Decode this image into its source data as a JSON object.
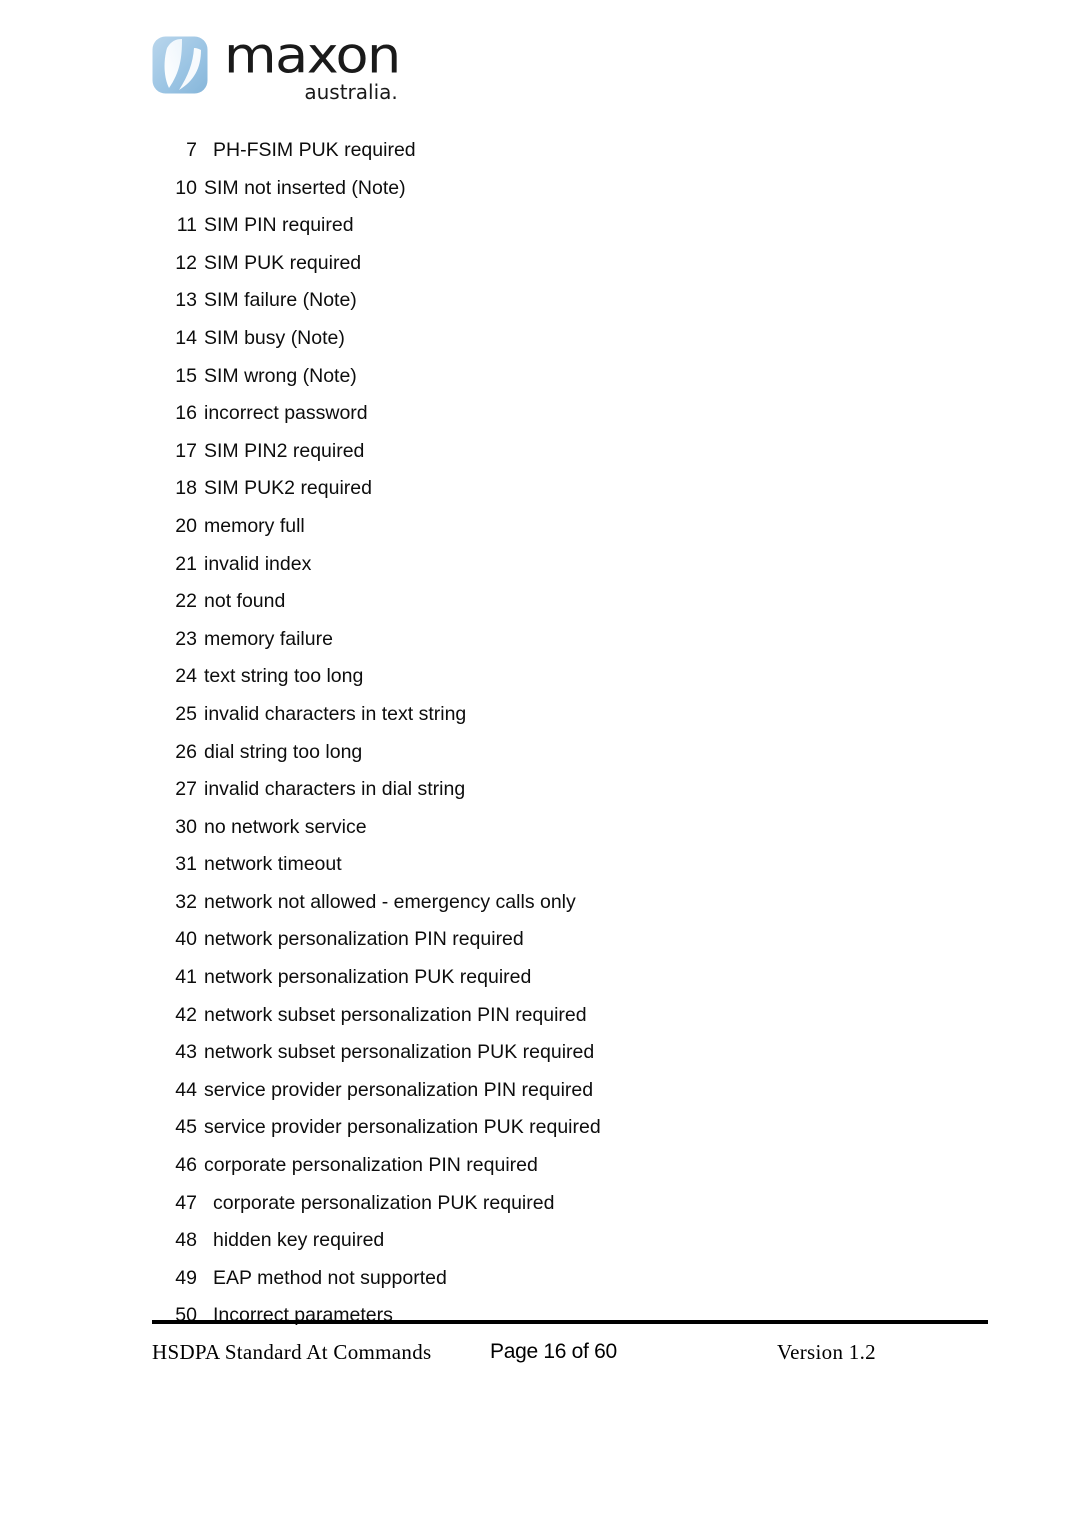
{
  "header": {
    "logo": {
      "mark_icon": "maxon-leaf-mark-icon",
      "mark_color": "#a9cbe6",
      "mark_color_dark": "#8cb9dd",
      "mark_highlight": "#ffffff",
      "wordmark": "maxon",
      "tagline": "australia.",
      "text_color": "#1a1a1a"
    }
  },
  "main": {
    "error_codes": [
      {
        "code": "7",
        "desc": "PH-FSIM PUK required",
        "wide": true
      },
      {
        "code": "10",
        "desc": "SIM not inserted (Note)",
        "wide": false
      },
      {
        "code": "11",
        "desc": "SIM PIN required",
        "wide": false
      },
      {
        "code": "12",
        "desc": "SIM PUK required",
        "wide": false
      },
      {
        "code": "13",
        "desc": "SIM failure (Note)",
        "wide": false
      },
      {
        "code": "14",
        "desc": "SIM busy (Note)",
        "wide": false
      },
      {
        "code": "15",
        "desc": "SIM wrong (Note)",
        "wide": false
      },
      {
        "code": "16",
        "desc": "incorrect password",
        "wide": false
      },
      {
        "code": "17",
        "desc": "SIM PIN2 required",
        "wide": false
      },
      {
        "code": "18",
        "desc": "SIM PUK2 required",
        "wide": false
      },
      {
        "code": "20",
        "desc": "memory full",
        "wide": false
      },
      {
        "code": "21",
        "desc": "invalid index",
        "wide": false
      },
      {
        "code": "22",
        "desc": "not found",
        "wide": false
      },
      {
        "code": "23",
        "desc": "memory failure",
        "wide": false
      },
      {
        "code": "24",
        "desc": "text string too long",
        "wide": false
      },
      {
        "code": "25",
        "desc": "invalid characters in text string",
        "wide": false
      },
      {
        "code": "26",
        "desc": "dial string too long",
        "wide": false
      },
      {
        "code": "27",
        "desc": "invalid characters in dial string",
        "wide": false
      },
      {
        "code": "30",
        "desc": "no network service",
        "wide": false
      },
      {
        "code": "31",
        "desc": "network timeout",
        "wide": false
      },
      {
        "code": "32",
        "desc": "network not allowed - emergency calls only",
        "wide": false
      },
      {
        "code": "40",
        "desc": "network personalization PIN required",
        "wide": false
      },
      {
        "code": "41",
        "desc": "network personalization PUK required",
        "wide": false
      },
      {
        "code": "42",
        "desc": "network subset personalization PIN required",
        "wide": false
      },
      {
        "code": "43",
        "desc": "network subset personalization PUK required",
        "wide": false
      },
      {
        "code": "44",
        "desc": "service provider personalization PIN required",
        "wide": false
      },
      {
        "code": "45",
        "desc": "service provider personalization PUK required",
        "wide": false
      },
      {
        "code": "46",
        "desc": "corporate personalization PIN required",
        "wide": false
      },
      {
        "code": "47",
        "desc": "corporate personalization PUK required",
        "wide": true
      },
      {
        "code": "48",
        "desc": "hidden key required",
        "wide": true
      },
      {
        "code": "49",
        "desc": "EAP method not supported",
        "wide": true
      },
      {
        "code": "50",
        "desc": "Incorrect parameters",
        "wide": true
      }
    ]
  },
  "footer": {
    "document_title": "HSDPA Standard At Commands",
    "page_label": "Page 16 of 60",
    "version_label": "Version 1.2"
  }
}
